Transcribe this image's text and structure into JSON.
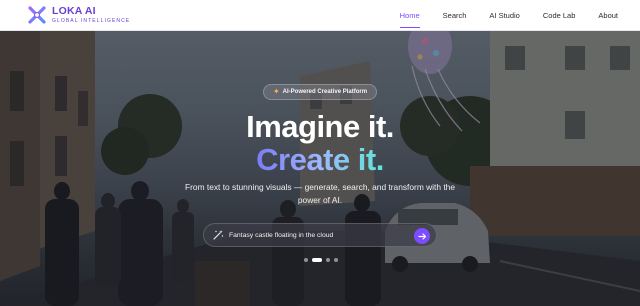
{
  "brand": {
    "name": "LOKA AI",
    "tagline": "GLOBAL INTELLIGENCE",
    "accent_color": "#7c4dff"
  },
  "nav": {
    "items": [
      {
        "label": "Home",
        "active": true
      },
      {
        "label": "Search",
        "active": false
      },
      {
        "label": "AI Studio",
        "active": false
      },
      {
        "label": "Code Lab",
        "active": false
      },
      {
        "label": "About",
        "active": false
      }
    ]
  },
  "hero": {
    "badge": {
      "icon": "sparkle-icon",
      "text": "AI-Powered Creative Platform"
    },
    "title_line1": "Imagine it.",
    "title_line2": "Create it.",
    "subtitle": "From text to stunning visuals — generate, search, and transform with the power of AI.",
    "search": {
      "icon": "magic-wand-icon",
      "value": "Fantasy castle floating in the cloud",
      "submit_icon": "arrow-right-icon"
    },
    "carousel": {
      "slide_count": 4,
      "active_index": 1
    }
  }
}
